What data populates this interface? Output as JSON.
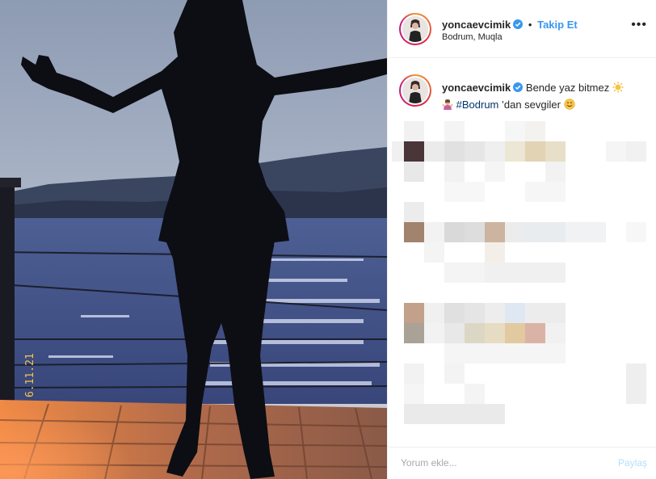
{
  "post": {
    "author": "yoncaevcimik",
    "follow_label": "Takip Et",
    "separator": "•",
    "location": "Bodrum, Muqla",
    "more_label": "•••",
    "caption_prefix": "Bende yaz bitmez",
    "hashtag": "#Bodrum",
    "caption_suffix": " ’dan sevgiler"
  },
  "photo": {
    "overlay_date": "6.11.21"
  },
  "footer": {
    "comment_placeholder": "Yorum ekle...",
    "share_label": "Paylaş"
  },
  "colors": {
    "accent_blue": "#3897f0",
    "share_disabled": "#b2dffc",
    "hashtag": "#00376b"
  }
}
